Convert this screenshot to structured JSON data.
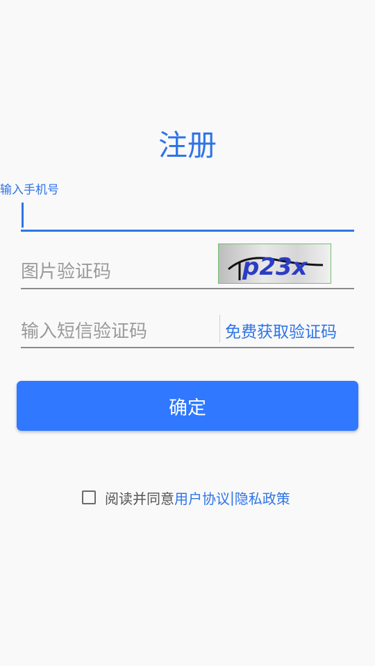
{
  "page": {
    "title": "注册"
  },
  "phone": {
    "label": "输入手机号",
    "value": ""
  },
  "captcha": {
    "placeholder": "图片验证码",
    "image_text": "p23x"
  },
  "sms": {
    "placeholder": "输入短信验证码",
    "get_code_label": "免费获取验证码"
  },
  "confirm": {
    "label": "确定"
  },
  "agreement": {
    "checked": false,
    "text": "阅读并同意",
    "user_agreement": "用户协议",
    "separator": "|",
    "privacy_policy": "隐私政策"
  },
  "colors": {
    "accent": "#2f74e6",
    "button": "#2f78ff",
    "background": "#f9f9f9"
  }
}
